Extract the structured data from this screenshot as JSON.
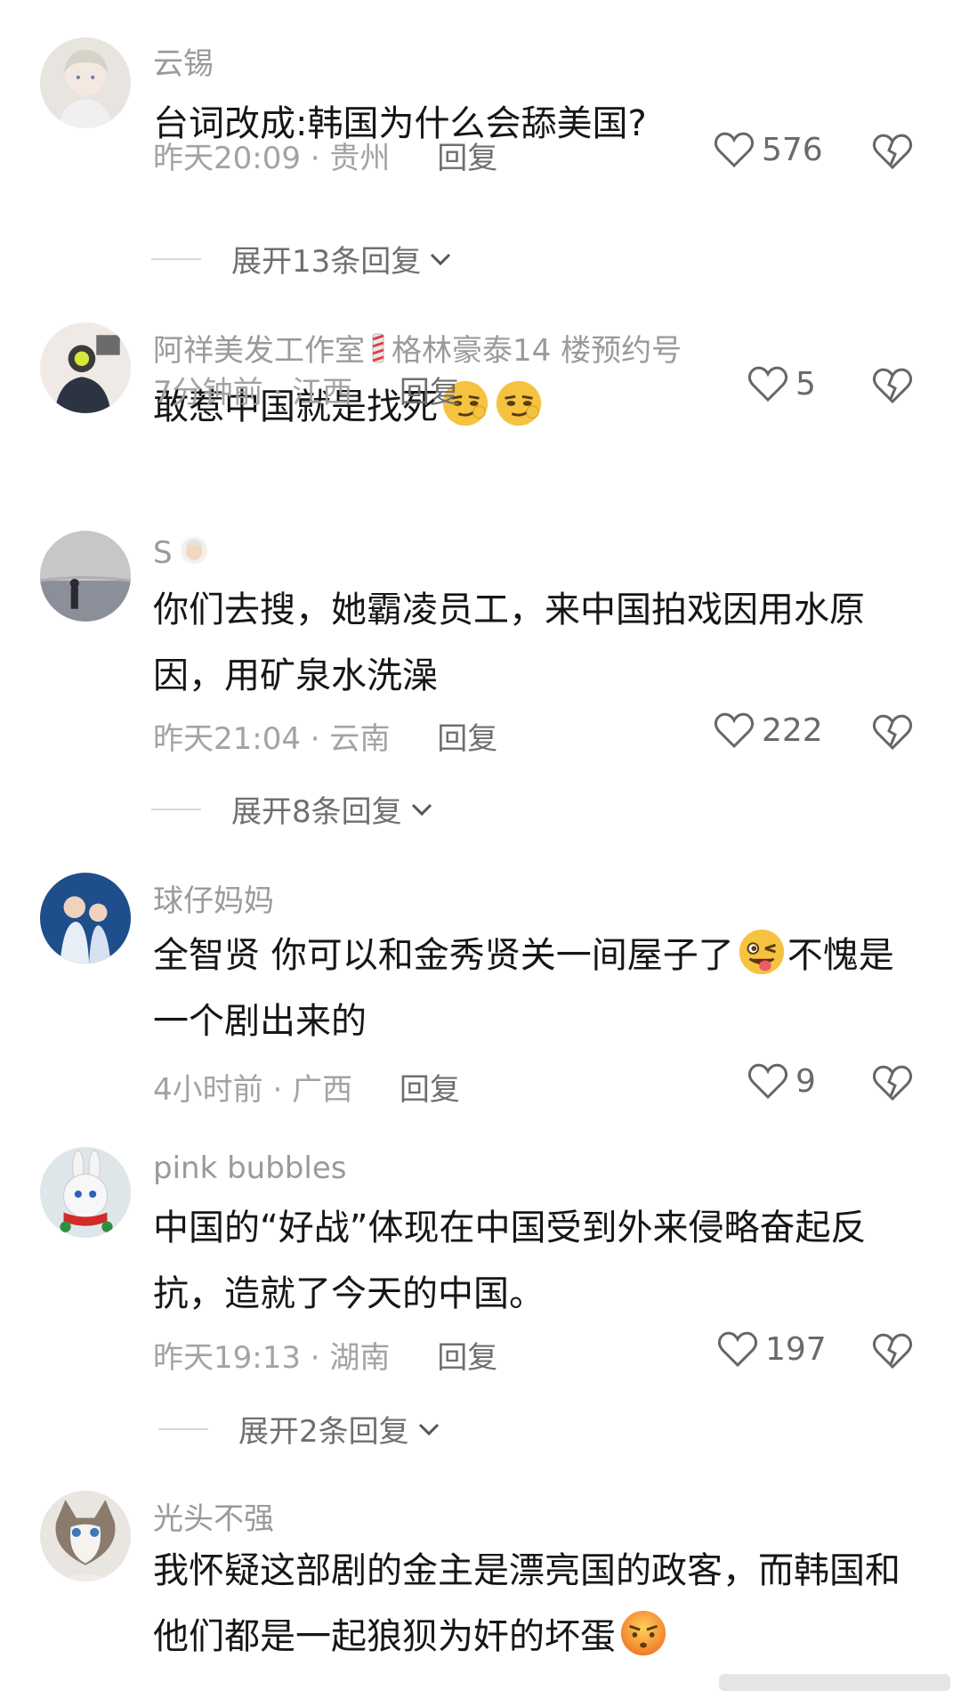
{
  "comments": [
    {
      "username": "云锡",
      "text": "台词改成:韩国为什么会舔美国?",
      "time": "昨天20:09",
      "location": "贵州",
      "reply_label": "回复",
      "likes": "576",
      "expand_label": "展开13条回复"
    },
    {
      "username": "阿祥美发工作室",
      "username_suffix": "格林豪泰14 楼预约号",
      "text": "敢惹中国就是找死",
      "time": "7分钟前",
      "location": "江西",
      "reply_label": "回复",
      "likes": "5"
    },
    {
      "username": "S",
      "text": "你们去搜，她霸凌员工，来中国拍戏因用水原因，用矿泉水洗澡",
      "time": "昨天21:04",
      "location": "云南",
      "reply_label": "回复",
      "likes": "222",
      "expand_label": "展开8条回复"
    },
    {
      "username": "球仔妈妈",
      "text": "全智贤  你可以和金秀贤关一间屋子了",
      "text_after_emoji": "不愧是一个剧出来的",
      "time": "4小时前",
      "location": "广西",
      "reply_label": "回复",
      "likes": "9"
    },
    {
      "username": "pink bubbles",
      "text": "中国的“好战”体现在中国受到外来侵略奋起反抗，造就了今天的中国。",
      "time": "昨天19:13",
      "location": "湖南",
      "reply_label": "回复",
      "likes": "197",
      "expand_label": "展开2条回复"
    },
    {
      "username": "光头不强",
      "text": "我怀疑这部剧的金主是漂亮国的政客，而韩国和他们都是一起狼狈为奸的坏蛋"
    }
  ],
  "separator": "·"
}
